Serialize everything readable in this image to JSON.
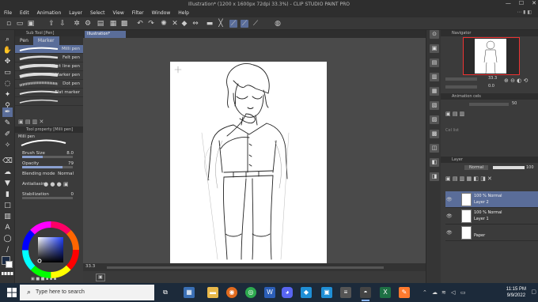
{
  "window": {
    "title": "Illustration* (1200 x 1600px 72dpi 33.3%) - CLIP STUDIO PAINT PRO",
    "minimize": "—",
    "maximize": "☐",
    "close": "✕"
  },
  "menu": [
    "File",
    "Edit",
    "Animation",
    "Layer",
    "Select",
    "View",
    "Filter",
    "Window",
    "Help"
  ],
  "document": {
    "tab_label": "Illustration*"
  },
  "subtool_panel": {
    "title": "Sub Tool [Pen]",
    "tabs": [
      "Pen",
      "Marker"
    ],
    "active_tab": "Marker",
    "brushes": [
      {
        "label": "Milli pen",
        "selected": true
      },
      {
        "label": "Felt pen",
        "selected": false
      },
      {
        "label": "Effect line pen",
        "selected": false
      },
      {
        "label": "Marker pen",
        "selected": false
      },
      {
        "label": "Dot pen",
        "selected": false
      },
      {
        "label": "Flat marker",
        "selected": false
      },
      {
        "label": "",
        "selected": false
      }
    ]
  },
  "tool_property": {
    "title": "Tool property [Milli pen]",
    "brush_name": "Milli pen",
    "rows": [
      {
        "label": "Brush Size",
        "value": "8.0",
        "level": 0.4
      },
      {
        "label": "Opacity",
        "value": "79",
        "level": 0.79
      },
      {
        "label": "Blending mode",
        "value": "Normal",
        "level": null
      },
      {
        "label": "Antialiasing",
        "value": "",
        "level": null
      },
      {
        "label": "Stabilization",
        "value": "0",
        "level": 0.0
      }
    ]
  },
  "color": {
    "main": "#1a2a44",
    "sub": "#ffffff"
  },
  "status": {
    "zoom": "33.3"
  },
  "navigator": {
    "title": "Navigator",
    "zoom": "33.3",
    "rotation": "0.0"
  },
  "animation_panel": {
    "title": "Animation cels",
    "value": "50",
    "note": "Cel list"
  },
  "layer_panel": {
    "title": "Layer",
    "blend": "Normal",
    "opacity": "100",
    "layers": [
      {
        "line1": "100 % Normal",
        "line2": "Layer 2",
        "selected": true
      },
      {
        "line1": "100 % Normal",
        "line2": "Layer 1",
        "selected": false
      },
      {
        "line1": "",
        "line2": "Paper",
        "selected": false
      }
    ]
  },
  "taskbar": {
    "search_placeholder": "Type here to search",
    "time": "11:15 PM",
    "date": "9/9/2022"
  },
  "accent_colors": {
    "selection": "#5a6d99",
    "panel_bg": "#3b3b3b",
    "taskbar": "#1c2a3a"
  }
}
